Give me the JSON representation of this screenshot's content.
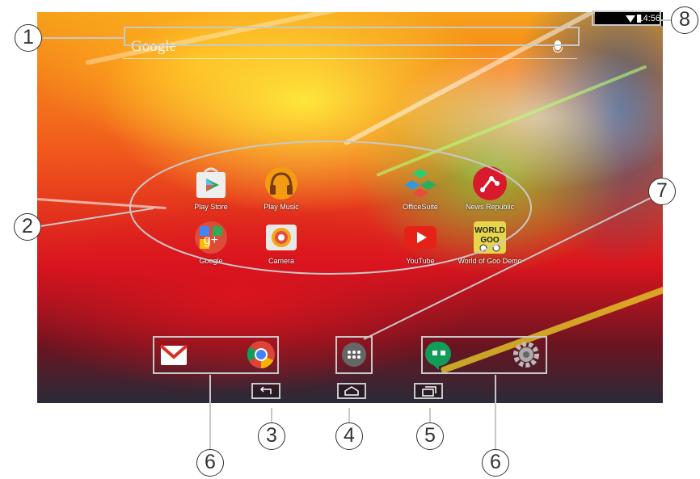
{
  "search": {
    "brand": "Google"
  },
  "status": {
    "time": "14:56"
  },
  "apps": [
    {
      "label": "Play Store",
      "icon": "play-store-icon"
    },
    {
      "label": "Play Music",
      "icon": "headphones-icon"
    },
    {
      "label": "OfficeSuite",
      "icon": "office-suite-icon"
    },
    {
      "label": "News Republic",
      "icon": "news-republic-icon"
    },
    {
      "label": "Google",
      "icon": "google-plus-icon"
    },
    {
      "label": "Camera",
      "icon": "camera-icon"
    },
    {
      "label": "YouTube",
      "icon": "youtube-icon"
    },
    {
      "label": "World of Goo Demo",
      "icon": "world-of-goo-icon"
    }
  ],
  "world_of_goo_logo": "WORLD GOO",
  "dock": [
    "gmail-icon",
    "chrome-icon",
    "app-drawer-icon",
    "hangouts-icon",
    "settings-icon"
  ],
  "nav": [
    "back-button",
    "home-button",
    "recent-apps-button"
  ],
  "callouts": [
    "1",
    "2",
    "3",
    "4",
    "5",
    "6",
    "6",
    "7",
    "8"
  ]
}
